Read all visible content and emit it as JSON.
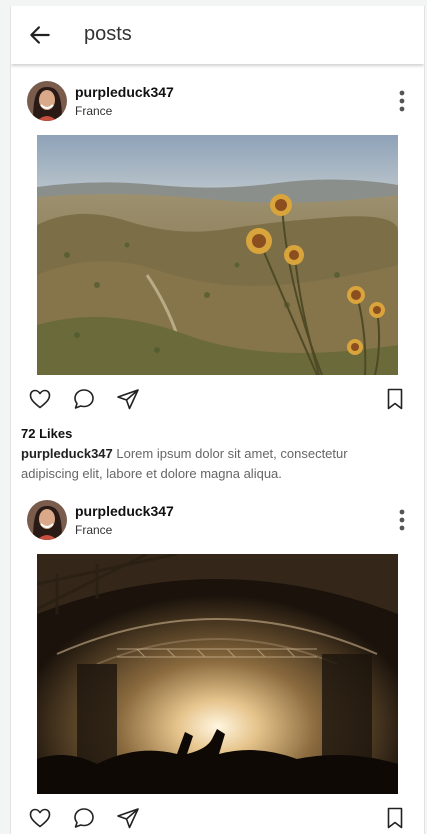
{
  "header": {
    "title": "posts"
  },
  "posts": [
    {
      "username": "purpleduck347",
      "location": "France",
      "likes": "72 Likes",
      "caption_user": "purpleduck347",
      "caption_text": " Lorem ipsum dolor sit amet, consectetur adipiscing elit, labore et dolore magna aliqua."
    },
    {
      "username": "purpleduck347",
      "location": "France"
    }
  ],
  "icons": [
    "arrow-left-icon",
    "more-vertical-icon",
    "heart-icon",
    "comment-icon",
    "send-icon",
    "bookmark-icon"
  ]
}
